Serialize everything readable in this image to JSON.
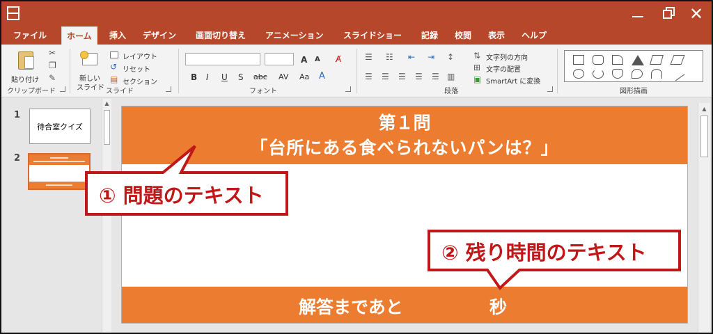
{
  "window": {
    "minimize_icon": "minimize-icon",
    "restore_icon": "restore-icon",
    "close_glyph": "✕"
  },
  "tabs": [
    {
      "label": "ファイル"
    },
    {
      "label": "ホーム"
    },
    {
      "label": "挿入"
    },
    {
      "label": "デザイン"
    },
    {
      "label": "画面切り替え"
    },
    {
      "label": "アニメーション"
    },
    {
      "label": "スライドショー"
    },
    {
      "label": "記録"
    },
    {
      "label": "校閲"
    },
    {
      "label": "表示"
    },
    {
      "label": "ヘルプ"
    }
  ],
  "ribbon": {
    "clipboard": {
      "paste": "貼り付け",
      "group": "クリップボード"
    },
    "slides": {
      "new_slide_line1": "新しい",
      "new_slide_line2": "スライド",
      "layout": "レイアウト",
      "reset": "リセット",
      "section": "セクション",
      "group": "スライド"
    },
    "font": {
      "group": "フォント",
      "grow": "A",
      "shrink": "A",
      "bold": "B",
      "italic": "I",
      "underline": "U",
      "shadow": "S",
      "strike": "abc",
      "spacing": "AV",
      "case": "Aa"
    },
    "paragraph": {
      "group": "段落",
      "text_direction": "文字列の方向",
      "align_text": "文字の配置",
      "smartart": "SmartArt に変換"
    },
    "drawing": {
      "group": "図形描画"
    }
  },
  "thumbnails": [
    {
      "number": "1",
      "text": "待合室クイズ"
    },
    {
      "number": "2"
    }
  ],
  "slide": {
    "title_line1": "第１問",
    "title_line2": "「台所にある食べられないパンは？」",
    "answer_prefix": "解答まであと",
    "seconds": "秒"
  },
  "callouts": {
    "question": "① 問題のテキスト",
    "timer": "② 残り時間のテキスト"
  },
  "colors": {
    "app_accent": "#b7472a",
    "slide_orange": "#ec7c30",
    "callout_red": "#c01818"
  }
}
